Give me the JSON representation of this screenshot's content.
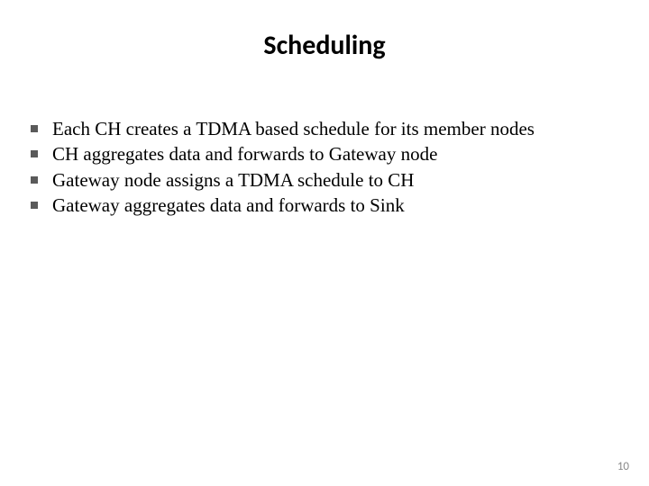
{
  "title": "Scheduling",
  "bullets": [
    "Each CH creates a TDMA based schedule for its member nodes",
    "CH aggregates data and forwards to Gateway node",
    "Gateway node assigns a TDMA schedule to CH",
    "Gateway  aggregates data and forwards to Sink"
  ],
  "page_number": "10"
}
